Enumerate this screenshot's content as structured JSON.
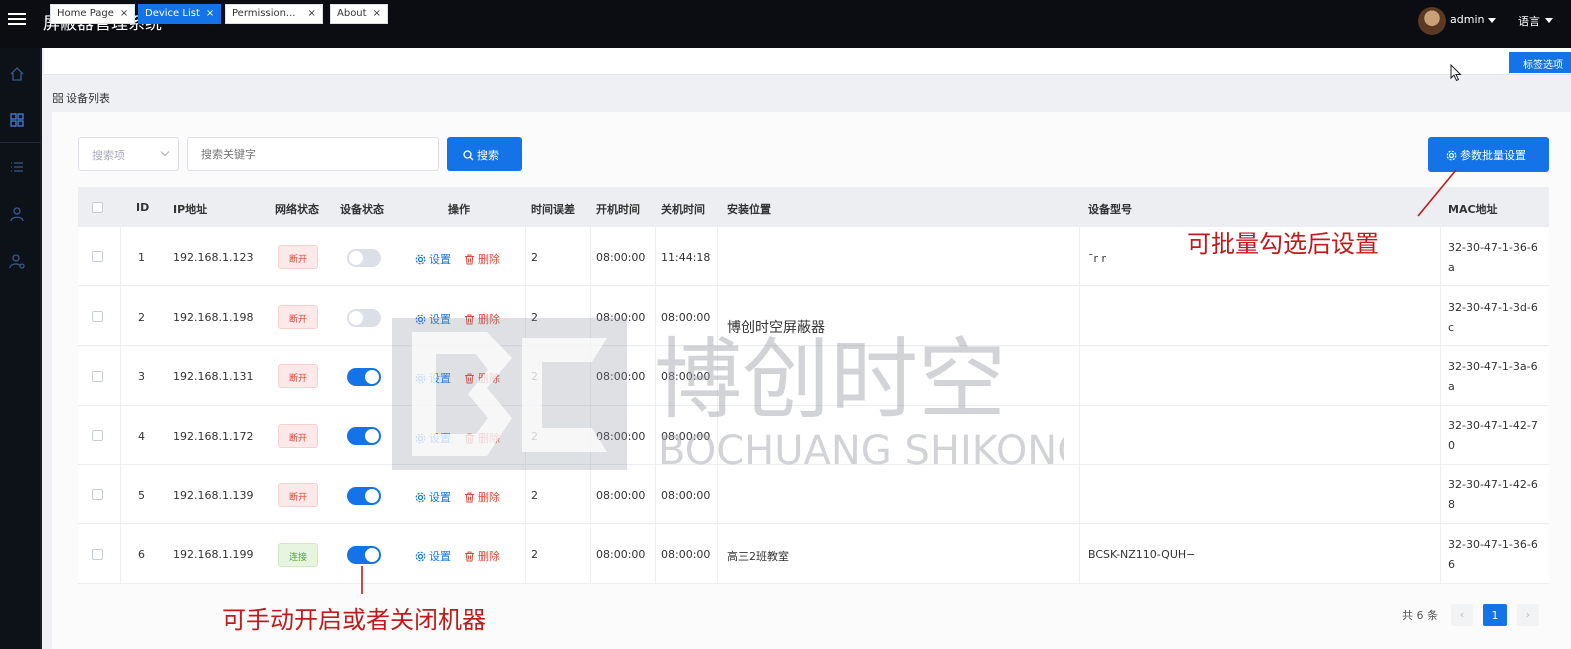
{
  "app": {
    "title": "屏蔽器管理系统"
  },
  "user": {
    "name": "admin",
    "language_label": "语言"
  },
  "tabs": [
    {
      "label": "Home Page",
      "close": "×"
    },
    {
      "label": "Device List",
      "close": "×"
    },
    {
      "label": "Permission...",
      "close": "×"
    },
    {
      "label": "About",
      "close": "×"
    }
  ],
  "tab_options_label": "标签选项",
  "breadcrumb": "设备列表",
  "search": {
    "select_placeholder": "搜索项",
    "input_placeholder": "搜索关键字",
    "button_label": "搜索"
  },
  "batch_button_label": "参数批量设置",
  "table": {
    "columns": [
      "ID",
      "IP地址",
      "网络状态",
      "设备状态",
      "操作",
      "时间误差",
      "开机时间",
      "关机时间",
      "安装位置",
      "设备型号",
      "MAC地址"
    ],
    "set_label": "设置",
    "delete_label": "删除",
    "rows": [
      {
        "id": "1",
        "ip": "192.168.1.123",
        "network": "断开",
        "network_state": "off",
        "device_on": false,
        "time_error": "2",
        "on_time": "08:00:00",
        "off_time": "11:44:18",
        "location": "",
        "model": "¯r r",
        "mac": "32-30-47-1-36-6a"
      },
      {
        "id": "2",
        "ip": "192.168.1.198",
        "network": "断开",
        "network_state": "off",
        "device_on": false,
        "time_error": "2",
        "on_time": "08:00:00",
        "off_time": "08:00:00",
        "location": "博创时空屏蔽器",
        "model": "",
        "mac": "32-30-47-1-3d-6c"
      },
      {
        "id": "3",
        "ip": "192.168.1.131",
        "network": "断开",
        "network_state": "off",
        "device_on": true,
        "time_error": "2",
        "on_time": "08:00:00",
        "off_time": "08:00:00",
        "location": "",
        "model": "",
        "mac": "32-30-47-1-3a-6a"
      },
      {
        "id": "4",
        "ip": "192.168.1.172",
        "network": "断开",
        "network_state": "off",
        "device_on": true,
        "time_error": "2",
        "on_time": "08:00:00",
        "off_time": "08:00:00",
        "location": "",
        "model": "",
        "mac": "32-30-47-1-42-70"
      },
      {
        "id": "5",
        "ip": "192.168.1.139",
        "network": "断开",
        "network_state": "off",
        "device_on": true,
        "time_error": "2",
        "on_time": "08:00:00",
        "off_time": "08:00:00",
        "location": "",
        "model": "",
        "mac": "32-30-47-1-42-68"
      },
      {
        "id": "6",
        "ip": "192.168.1.199",
        "network": "连接",
        "network_state": "on",
        "device_on": true,
        "time_error": "2",
        "on_time": "08:00:00",
        "off_time": "08:00:00",
        "location": "高三2班教室",
        "model": "BCSK-NZ110-QUH−",
        "mac": "32-30-47-1-36-66"
      }
    ]
  },
  "annotations": {
    "batch_note": "可批量勾选后设置",
    "switch_note": "可手动开启或者关闭机器"
  },
  "watermark": {
    "cn": "博创时空",
    "en": "BOCHUANG SHIKONG"
  },
  "pagination": {
    "total_label": "共 6 条",
    "current_page": "1",
    "prev": "‹",
    "next": "›"
  },
  "colors": {
    "primary": "#1473e6",
    "danger": "#e0473a",
    "success": "#58a62f",
    "topbar": "#0b0d12",
    "annotation": "#c11a1a"
  }
}
